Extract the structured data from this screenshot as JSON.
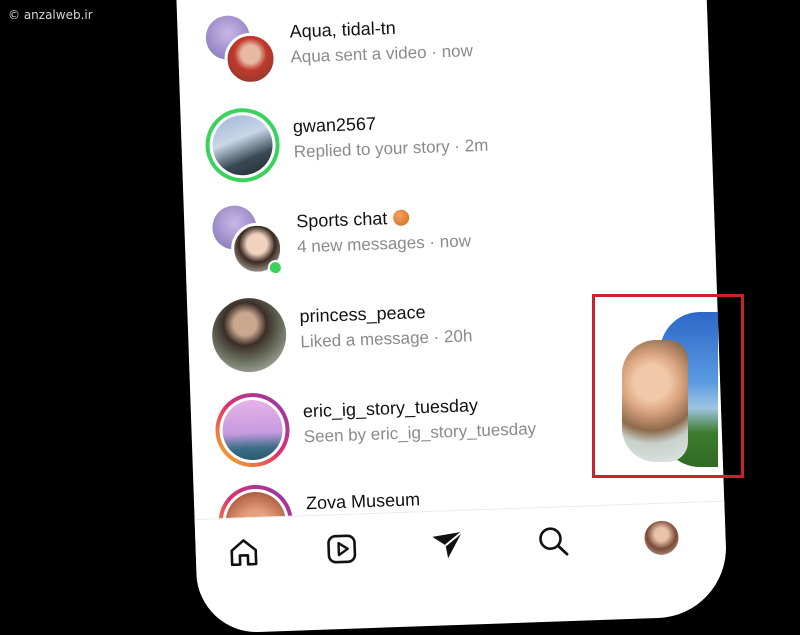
{
  "watermark": "© anzalweb.ir",
  "threads": [
    {
      "name": "Aqua, tidal-tn",
      "subtitle": "Aqua sent a video · now",
      "avatar": "group"
    },
    {
      "name": "gwan2567",
      "subtitle": "Replied to your story · 2m",
      "avatar": "story-green"
    },
    {
      "name": "Sports chat",
      "subtitle": "4 new messages · now",
      "avatar": "group-online",
      "emoji": "basketball-icon"
    },
    {
      "name": "princess_peace",
      "subtitle": "Liked a message · 20h",
      "avatar": "plain"
    },
    {
      "name": "eric_ig_story_tuesday",
      "subtitle": "Seen by eric_ig_story_tuesday",
      "avatar": "story-gradient"
    },
    {
      "name": "Zova Museum",
      "subtitle": "",
      "avatar": "story-gradient"
    }
  ],
  "tabbar": {
    "items": [
      "home-icon",
      "reels-icon",
      "messages-icon",
      "search-icon",
      "profile-avatar"
    ]
  },
  "colors": {
    "story_ring_green": "#3bd15d",
    "story_ring_gradient": [
      "#f5c518",
      "#e1306c",
      "#833ab4"
    ],
    "highlight_box": "#c8222b",
    "online": "#3bd15d"
  }
}
